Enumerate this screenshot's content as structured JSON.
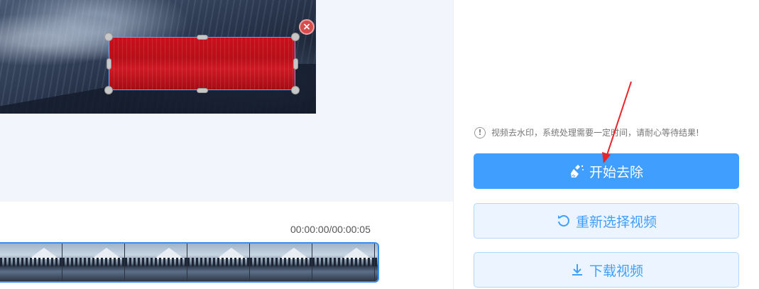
{
  "preview": {
    "close_glyph": "×"
  },
  "timeline": {
    "timecode": "00:00:00/00:00:05",
    "frame_count": 7
  },
  "sidebar": {
    "notice_text": "视频去水印，系统处理需要一定时间，请耐心等待结果!",
    "start_button": "开始去除",
    "reselect_button": "重新选择视频",
    "download_button": "下载视频"
  },
  "colors": {
    "primary": "#409eff",
    "watermark_fill": "#c8101c",
    "arrow": "#e8262a"
  },
  "icons": {
    "notice": "info-circle-icon",
    "start": "broom-icon",
    "reselect": "refresh-icon",
    "download": "download-icon",
    "close": "close-icon"
  }
}
